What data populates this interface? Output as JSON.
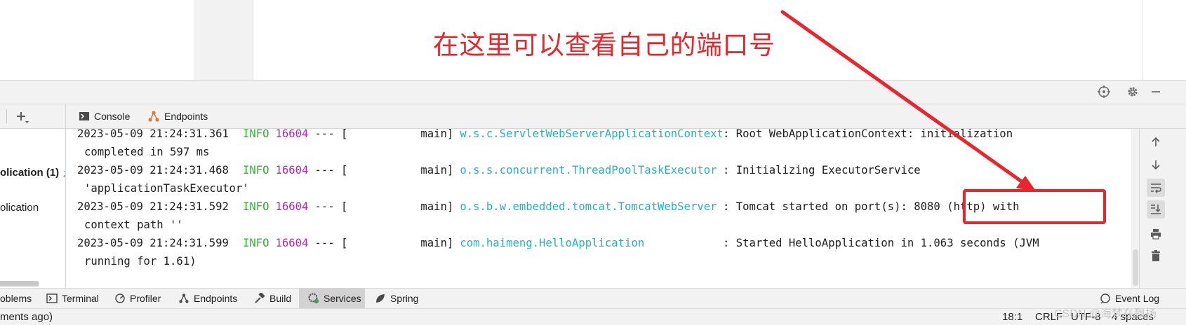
{
  "annotation": {
    "text": "在这里可以查看自己的端口号",
    "color": "#e8262b"
  },
  "console_tabs": [
    {
      "label": "Console",
      "icon": "console-icon"
    },
    {
      "label": "Endpoints",
      "icon": "endpoints-icon"
    }
  ],
  "left_tree": {
    "selected_label": "olication (1)",
    "selected_link": ":8",
    "item_label": "olication"
  },
  "console": {
    "lines": [
      {
        "ts": "2023-05-09 21:24:31.361",
        "level": "INFO",
        "pid": "16604",
        "sep": "--- [",
        "thread": "main]",
        "logger": "w.s.c.ServletWebServerApplicationContext",
        "msg": ": Root WebApplicationContext: initialization"
      },
      {
        "cont": "completed in 597 ms"
      },
      {
        "ts": "2023-05-09 21:24:31.468",
        "level": "INFO",
        "pid": "16604",
        "sep": "--- [",
        "thread": "main]",
        "logger": "o.s.s.concurrent.ThreadPoolTaskExecutor",
        "msg": ": Initializing ExecutorService"
      },
      {
        "cont": "'applicationTaskExecutor'"
      },
      {
        "ts": "2023-05-09 21:24:31.592",
        "level": "INFO",
        "pid": "16604",
        "sep": "--- [",
        "thread": "main]",
        "logger": "o.s.b.w.embedded.tomcat.TomcatWebServer",
        "msg": ": Tomcat started on port(s): 8080 (http) with"
      },
      {
        "cont": "context path ''"
      },
      {
        "ts": "2023-05-09 21:24:31.599",
        "level": "INFO",
        "pid": "16604",
        "sep": "--- [",
        "thread": "main]",
        "logger": "com.haimeng.HelloApplication",
        "msg": ": Started HelloApplication in 1.063 seconds (JVM"
      },
      {
        "cont": "running for 1.61)"
      }
    ],
    "colors": {
      "info": "#28b52a",
      "pid": "#b325b5",
      "logger": "#1fb2c7"
    }
  },
  "bottom_tabs": [
    {
      "label": "oblems",
      "icon": "problems-icon"
    },
    {
      "label": "Terminal",
      "icon": "terminal-icon"
    },
    {
      "label": "Profiler",
      "icon": "profiler-icon"
    },
    {
      "label": "Endpoints",
      "icon": "endpoints-icon"
    },
    {
      "label": "Build",
      "icon": "hammer-icon"
    },
    {
      "label": "Services",
      "icon": "services-icon",
      "active": true
    },
    {
      "label": "Spring",
      "icon": "spring-leaf-icon"
    }
  ],
  "event_log": {
    "label": "Event Log"
  },
  "status_bar": {
    "left_text": "ments ago)",
    "position": "18:1",
    "line_ending": "CRLF",
    "encoding": "UTF-8",
    "indent": "4 spaces"
  },
  "watermark": "CSDN @海梦在飘扬"
}
